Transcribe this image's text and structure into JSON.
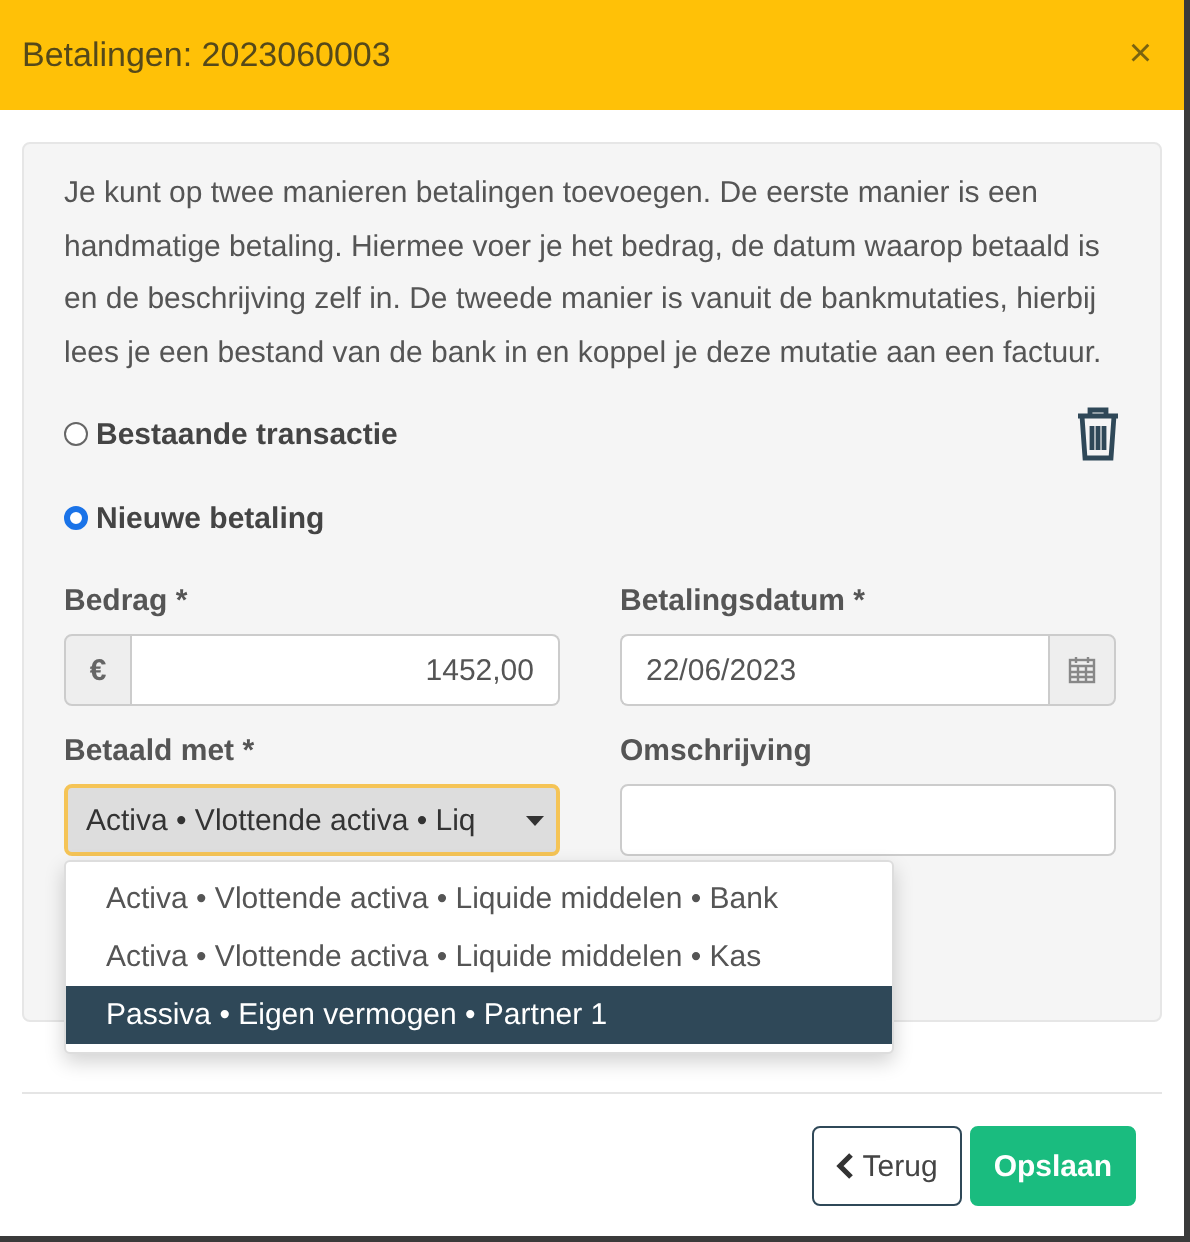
{
  "dialog": {
    "title": "Betalingen: 2023060003",
    "close": "×"
  },
  "intro": "Je kunt op twee manieren betalingen toevoegen. De eerste manier is een handmatige betaling. Hiermee voer je het bedrag, de datum waarop betaald is en de beschrijving zelf in. De tweede manier is vanuit de bankmutaties, hierbij lees je een bestand van de bank in en koppel je deze mutatie aan een factuur.",
  "options": [
    {
      "label": "Bestaande transactie",
      "selected": false
    },
    {
      "label": "Nieuwe betaling",
      "selected": true
    }
  ],
  "amount": {
    "label": "Bedrag *",
    "prefix": "€",
    "value": "1452,00"
  },
  "date": {
    "label": "Betalingsdatum *",
    "value": "22/06/2023"
  },
  "paid_with": {
    "label": "Betaald met *",
    "value": "Activa • Vlottende activa • Liq",
    "expanded": true,
    "options": [
      {
        "label": "Activa • Vlottende activa • Liquide middelen • Bank",
        "selected": false
      },
      {
        "label": "Activa • Vlottende activa • Liquide middelen • Kas",
        "selected": false
      },
      {
        "label": "Passiva • Eigen vermogen • Partner 1",
        "selected": true
      }
    ]
  },
  "description": {
    "label": "Omschrijving"
  },
  "buttons": [
    {
      "label": "Terug",
      "kind": "back"
    },
    {
      "label": "Opslaan",
      "kind": "primary"
    }
  ]
}
